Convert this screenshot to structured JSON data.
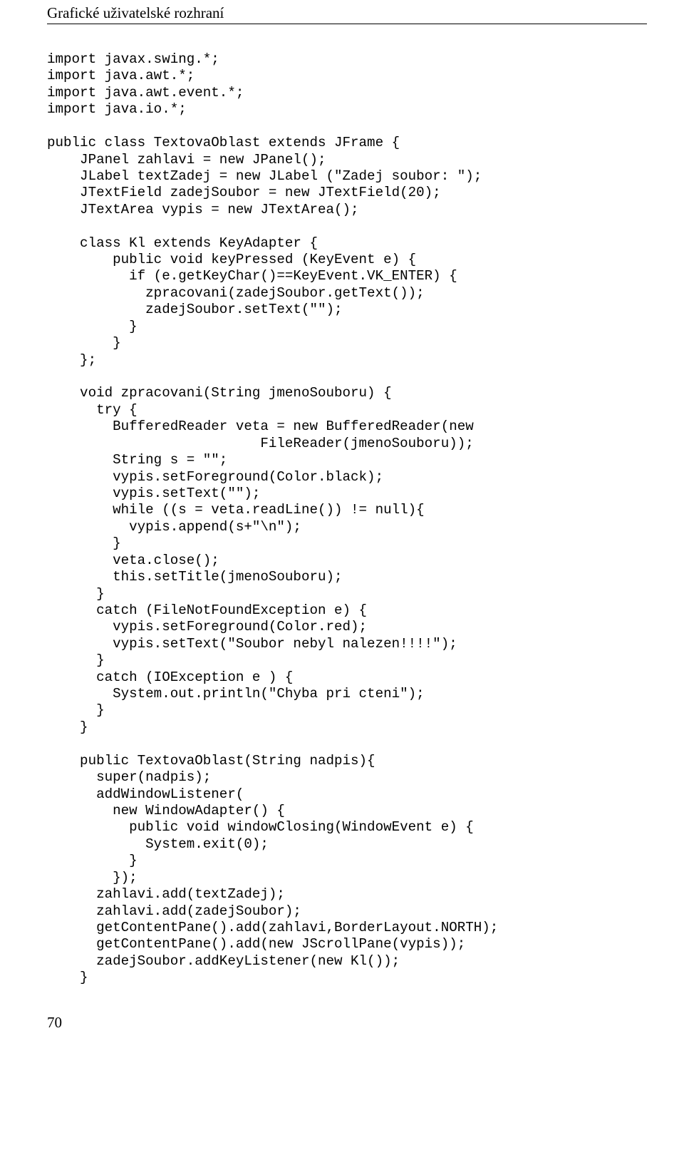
{
  "header": "Grafické uživatelské rozhraní",
  "code": "import javax.swing.*;\nimport java.awt.*;\nimport java.awt.event.*;\nimport java.io.*;\n\npublic class TextovaOblast extends JFrame {\n    JPanel zahlavi = new JPanel();\n    JLabel textZadej = new JLabel (\"Zadej soubor: \");\n    JTextField zadejSoubor = new JTextField(20);\n    JTextArea vypis = new JTextArea();\n\n    class Kl extends KeyAdapter {\n        public void keyPressed (KeyEvent e) {\n          if (e.getKeyChar()==KeyEvent.VK_ENTER) {\n            zpracovani(zadejSoubor.getText());\n            zadejSoubor.setText(\"\");\n          }\n        }\n    };\n\n    void zpracovani(String jmenoSouboru) {\n      try {\n        BufferedReader veta = new BufferedReader(new\n                          FileReader(jmenoSouboru));\n        String s = \"\";\n        vypis.setForeground(Color.black);\n        vypis.setText(\"\");\n        while ((s = veta.readLine()) != null){\n          vypis.append(s+\"\\n\");\n        }\n        veta.close();\n        this.setTitle(jmenoSouboru);\n      }\n      catch (FileNotFoundException e) {\n        vypis.setForeground(Color.red);\n        vypis.setText(\"Soubor nebyl nalezen!!!!\");\n      }\n      catch (IOException e ) {\n        System.out.println(\"Chyba pri cteni\");\n      }\n    }\n\n    public TextovaOblast(String nadpis){\n      super(nadpis);\n      addWindowListener(\n        new WindowAdapter() {\n          public void windowClosing(WindowEvent e) {\n            System.exit(0);\n          }\n        });\n      zahlavi.add(textZadej);\n      zahlavi.add(zadejSoubor);\n      getContentPane().add(zahlavi,BorderLayout.NORTH);\n      getContentPane().add(new JScrollPane(vypis));\n      zadejSoubor.addKeyListener(new Kl());\n    }",
  "page_number": "70"
}
